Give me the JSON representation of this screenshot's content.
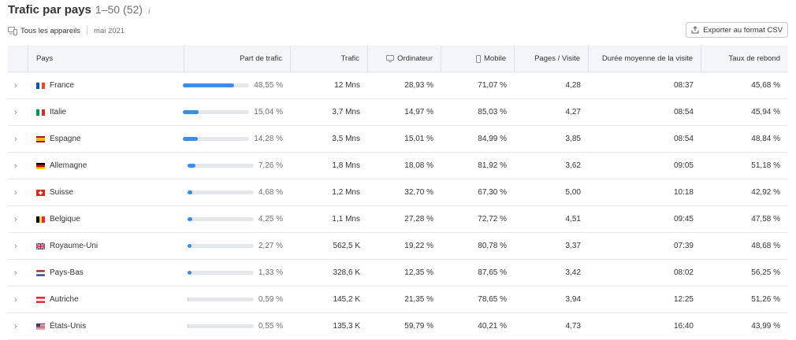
{
  "header": {
    "title": "Trafic par pays",
    "range": "1–50",
    "total": "(52)"
  },
  "filters": {
    "devices_label": "Tous les appareils",
    "date": "mai 2021"
  },
  "export_button": {
    "label": "Exporter au format CSV"
  },
  "columns": {
    "pays": "Pays",
    "share": "Part de trafic",
    "trafic": "Trafic",
    "desktop": "Ordinateur",
    "mobile": "Mobile",
    "pages": "Pages / Visite",
    "duration": "Durée moyenne de la visite",
    "bounce": "Taux de rebond"
  },
  "accent_color": "#3a8ee6",
  "rows": [
    {
      "country": "France",
      "flag": "fr",
      "share": "48,55 %",
      "share_fraction": 0.4855,
      "trafic": "12 Mns",
      "desktop": "28,93 %",
      "mobile": "71,07 %",
      "pages": "4,28",
      "duration": "08:37",
      "bounce": "45,68 %"
    },
    {
      "country": "Italie",
      "flag": "it",
      "share": "15,04 %",
      "share_fraction": 0.1504,
      "trafic": "3,7 Mns",
      "desktop": "14,97 %",
      "mobile": "85,03 %",
      "pages": "4,27",
      "duration": "08:54",
      "bounce": "45,94 %"
    },
    {
      "country": "Espagne",
      "flag": "es",
      "share": "14,28 %",
      "share_fraction": 0.1428,
      "trafic": "3,5 Mns",
      "desktop": "15,01 %",
      "mobile": "84,99 %",
      "pages": "3,85",
      "duration": "08:54",
      "bounce": "48,84 %"
    },
    {
      "country": "Allemagne",
      "flag": "de",
      "share": "7,26 %",
      "share_fraction": 0.0726,
      "trafic": "1,8 Mns",
      "desktop": "18,08 %",
      "mobile": "81,92 %",
      "pages": "3,62",
      "duration": "09:05",
      "bounce": "51,18 %"
    },
    {
      "country": "Suisse",
      "flag": "ch",
      "share": "4,68 %",
      "share_fraction": 0.0468,
      "trafic": "1,2 Mns",
      "desktop": "32,70 %",
      "mobile": "67,30 %",
      "pages": "5,00",
      "duration": "10:18",
      "bounce": "42,92 %"
    },
    {
      "country": "Belgique",
      "flag": "be",
      "share": "4,25 %",
      "share_fraction": 0.0425,
      "trafic": "1,1 Mns",
      "desktop": "27,28 %",
      "mobile": "72,72 %",
      "pages": "4,51",
      "duration": "09:45",
      "bounce": "47,58 %"
    },
    {
      "country": "Royaume-Uni",
      "flag": "gb",
      "share": "2,27 %",
      "share_fraction": 0.0227,
      "trafic": "562,5 K",
      "desktop": "19,22 %",
      "mobile": "80,78 %",
      "pages": "3,37",
      "duration": "07:39",
      "bounce": "48,68 %"
    },
    {
      "country": "Pays-Bas",
      "flag": "nl",
      "share": "1,33 %",
      "share_fraction": 0.0133,
      "trafic": "328,6 K",
      "desktop": "12,35 %",
      "mobile": "87,65 %",
      "pages": "3,42",
      "duration": "08:02",
      "bounce": "56,25 %"
    },
    {
      "country": "Autriche",
      "flag": "at",
      "share": "0,59 %",
      "share_fraction": 0.0059,
      "trafic": "145,2 K",
      "desktop": "21,35 %",
      "mobile": "78,65 %",
      "pages": "3,94",
      "duration": "12:25",
      "bounce": "51,26 %"
    },
    {
      "country": "États-Unis",
      "flag": "us",
      "share": "0,55 %",
      "share_fraction": 0.0055,
      "trafic": "135,3 K",
      "desktop": "59,79 %",
      "mobile": "40,21 %",
      "pages": "4,73",
      "duration": "16:40",
      "bounce": "43,99 %"
    }
  ]
}
